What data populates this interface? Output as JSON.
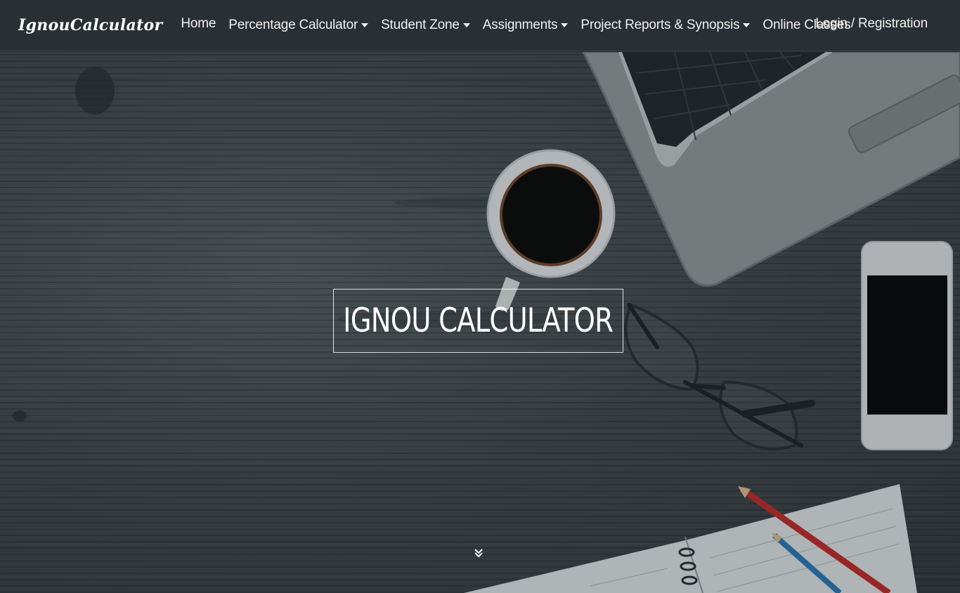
{
  "brand": "IgnouCalculator",
  "nav": {
    "home": "Home",
    "percentage_calculator": "Percentage Calculator",
    "student_zone": "Student Zone",
    "assignments": "Assignments",
    "project_reports": "Project Reports & Synopsis",
    "online_classes": "Online Classes",
    "login": "Login / Registration"
  },
  "hero": {
    "title": "IGNOU CALCULATOR",
    "scroll_icon": "double-chevron-down-icon"
  },
  "colors": {
    "navbar_bg": "#2a2f33",
    "nav_text": "#f0f0f0",
    "hero_text": "#ffffff"
  }
}
